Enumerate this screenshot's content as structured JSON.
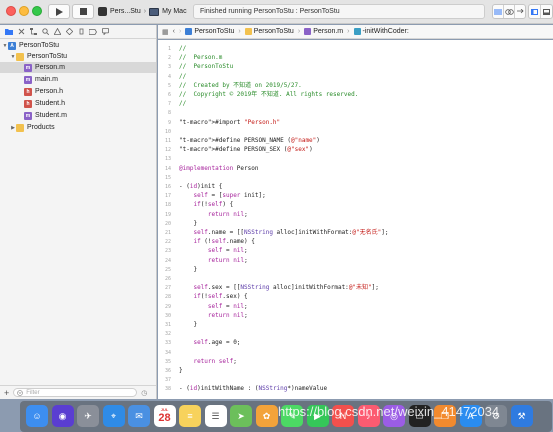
{
  "toolbar": {
    "scheme_app": "Pers...Stu",
    "scheme_device": "My Mac",
    "status_text": "Finished running PersonToStu : PersonToStu"
  },
  "navigator": {
    "items": [
      {
        "label": "PersonToStu",
        "icon": "project-icon"
      },
      {
        "label": "PersonToStu",
        "icon": "folder-icon"
      },
      {
        "label": "Person.m",
        "icon": "m-file-icon"
      },
      {
        "label": "main.m",
        "icon": "m-file-icon"
      },
      {
        "label": "Person.h",
        "icon": "h-file-icon"
      },
      {
        "label": "Student.h",
        "icon": "h-file-icon"
      },
      {
        "label": "Student.m",
        "icon": "m-file-icon"
      },
      {
        "label": "Products",
        "icon": "folder-icon"
      }
    ],
    "filter_placeholder": "Filter"
  },
  "jumpbar": {
    "project": "PersonToStu",
    "group": "PersonToStu",
    "file": "Person.m",
    "symbol": "-initWithCoder:"
  },
  "editor": {
    "lines": [
      {
        "n": "1",
        "text": "//"
      },
      {
        "n": "2",
        "text": "//  Person.m"
      },
      {
        "n": "3",
        "text": "//  PersonToStu"
      },
      {
        "n": "4",
        "text": "//"
      },
      {
        "n": "5",
        "text": "//  Created by 不知道 on 2019/5/27."
      },
      {
        "n": "6",
        "text": "//  Copyright © 2019年 不知道. All rights reserved."
      },
      {
        "n": "7",
        "text": "//"
      },
      {
        "n": "8",
        "text": ""
      },
      {
        "n": "9",
        "text": "#import \"Person.h\""
      },
      {
        "n": "10",
        "text": ""
      },
      {
        "n": "11",
        "text": "#define PERSON_NAME (@\"name\")"
      },
      {
        "n": "12",
        "text": "#define PERSON_SEX (@\"sex\")"
      },
      {
        "n": "13",
        "text": ""
      },
      {
        "n": "14",
        "text": "@implementation Person"
      },
      {
        "n": "15",
        "text": ""
      },
      {
        "n": "16",
        "text": "- (id)init {"
      },
      {
        "n": "17",
        "text": "    self = [super init];"
      },
      {
        "n": "18",
        "text": "    if(!self) {"
      },
      {
        "n": "19",
        "text": "        return nil;"
      },
      {
        "n": "20",
        "text": "    }"
      },
      {
        "n": "21",
        "text": "    self.name = [[NSString alloc]initWithFormat:@\"无名氏\"];"
      },
      {
        "n": "22",
        "text": "    if (!self.name) {"
      },
      {
        "n": "23",
        "text": "        self = nil;"
      },
      {
        "n": "24",
        "text": "        return nil;"
      },
      {
        "n": "25",
        "text": "    }"
      },
      {
        "n": "26",
        "text": ""
      },
      {
        "n": "27",
        "text": "    self.sex = [[NSString alloc]initWithFormat:@\"未知\"];"
      },
      {
        "n": "28",
        "text": "    if(!self.sex) {"
      },
      {
        "n": "29",
        "text": "        self = nil;"
      },
      {
        "n": "30",
        "text": "        return nil;"
      },
      {
        "n": "31",
        "text": "    }"
      },
      {
        "n": "32",
        "text": ""
      },
      {
        "n": "33",
        "text": "    self.age = 0;"
      },
      {
        "n": "34",
        "text": ""
      },
      {
        "n": "35",
        "text": "    return self;"
      },
      {
        "n": "36",
        "text": "}"
      },
      {
        "n": "37",
        "text": ""
      },
      {
        "n": "38",
        "text": "- (id)initWithName : (NSString*)nameValue"
      }
    ]
  },
  "dock": {
    "calendar_month": "JUL",
    "calendar_day": "28"
  },
  "watermark": "https://blog.csdn.net/weixin_41472034",
  "colors": {
    "comment": "#2a8c2a",
    "string": "#c41a16",
    "keyword": "#a7249c",
    "selection": "#d8d8d8"
  }
}
